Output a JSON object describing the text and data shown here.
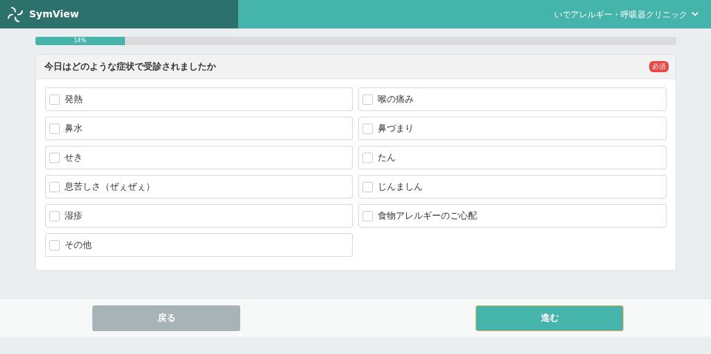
{
  "header": {
    "brand": "SymView",
    "clinic": "いでアレルギー・呼吸器クリニック"
  },
  "progress": {
    "level": 0.14,
    "label": "14%"
  },
  "question": {
    "title": "今日はどのような症状で受診されましたか",
    "badge": "必須",
    "options": [
      {
        "label": "発熱",
        "checked": false
      },
      {
        "label": "喉の痛み",
        "checked": false
      },
      {
        "label": "鼻水",
        "checked": false
      },
      {
        "label": "鼻づまり",
        "checked": false
      },
      {
        "label": "せき",
        "checked": false
      },
      {
        "label": "たん",
        "checked": false
      },
      {
        "label": "息苦しさ（ぜぇぜぇ）",
        "checked": false
      },
      {
        "label": "じんましん",
        "checked": false
      },
      {
        "label": "湿疹",
        "checked": false
      },
      {
        "label": "食物アレルギーのご心配",
        "checked": false
      },
      {
        "label": "その他",
        "checked": false
      }
    ]
  },
  "buttons": {
    "back": "戻る",
    "next": "進む"
  }
}
